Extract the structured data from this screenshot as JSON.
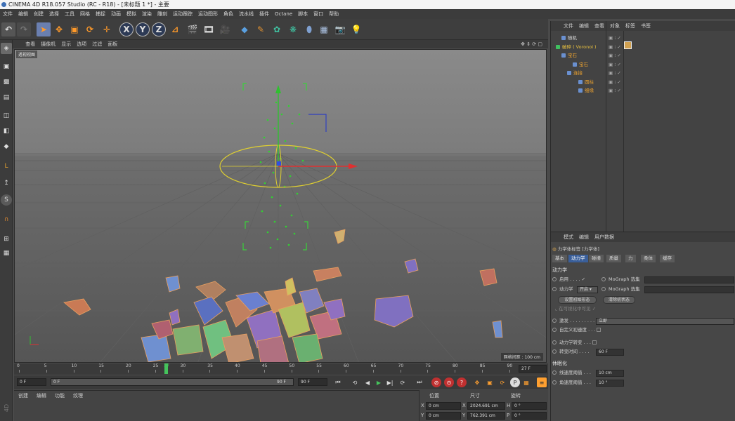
{
  "title": "CINEMA 4D R18.057 Studio (RC - R18) - [未标题 1 *] - 主要",
  "menu": [
    "文件",
    "编辑",
    "创建",
    "选择",
    "工具",
    "网格",
    "捕捉",
    "动画",
    "模拟",
    "渲染",
    "雕刻",
    "运动跟踪",
    "运动图形",
    "角色",
    "流水线",
    "插件",
    "Octane",
    "脚本",
    "窗口",
    "帮助"
  ],
  "toolbar": {
    "undo_icon": "undo-icon",
    "x": "X",
    "y": "Y",
    "z": "Z"
  },
  "viewport_menu": [
    "查看",
    "摄像机",
    "显示",
    "选项",
    "过滤",
    "面板"
  ],
  "viewport": {
    "label": "透视视图",
    "grid_spacing": "网格间距 : 100 cm"
  },
  "timeline": {
    "ticks": [
      "0",
      "5",
      "10",
      "15",
      "20",
      "25",
      "27",
      "30",
      "35",
      "40",
      "45",
      "50",
      "55",
      "60",
      "65",
      "70",
      "75",
      "80",
      "85",
      "90"
    ],
    "current": "27 F"
  },
  "transport": {
    "start": "0 F",
    "range_start": "0 F",
    "range_end": "90 F",
    "end": "90 F"
  },
  "bottom_tabs": [
    "创建",
    "编辑",
    "功能",
    "纹理"
  ],
  "coords": {
    "headers": [
      "位置",
      "尺寸",
      "旋转"
    ],
    "rows": [
      {
        "a": "X",
        "pos": "0 cm",
        "b": "X",
        "size": "2024.691 cm",
        "c": "H",
        "rot": "0 °"
      },
      {
        "a": "Y",
        "pos": "0 cm",
        "b": "Y",
        "size": "762.391 cm",
        "c": "P",
        "rot": "0 °"
      }
    ]
  },
  "object_manager": {
    "menu": [
      "文件",
      "编辑",
      "查看",
      "对象",
      "标签",
      "书签"
    ],
    "items": [
      {
        "label": "随机",
        "color": "#d8d8d8",
        "indent": 10
      },
      {
        "label": "破碎 ( Voronoi )",
        "color": "#e8c040",
        "indent": 2
      },
      {
        "label": "宝石",
        "color": "#e8a030",
        "indent": 10
      },
      {
        "label": "宝石",
        "color": "#e8a030",
        "indent": 26
      },
      {
        "label": "连接",
        "color": "#e8a030",
        "indent": 18
      },
      {
        "label": "圆柱",
        "color": "#e8a030",
        "indent": 34
      },
      {
        "label": "细缘",
        "color": "#e8a030",
        "indent": 34
      }
    ]
  },
  "attributes": {
    "menu": [
      "模式",
      "编辑",
      "用户数据"
    ],
    "header": "力学体标签 [力学体]",
    "tabs": [
      "基本",
      "动力学",
      "碰撞",
      "质量",
      "力",
      "柔体",
      "缓存"
    ],
    "active_tab": "动力学",
    "section_dynamics": "动力学",
    "enable_label": "启用",
    "enable_check": "✓",
    "mograph_sel_1": "MoGraph 选集",
    "dynamics_label": "动力学",
    "dynamics_value": "开启",
    "mograph_sel_2": "MoGraph 选集",
    "btn_set_initial": "设置初始形态",
    "btn_clear_initial": "清除初状态",
    "visible_label": "在可视化中可见",
    "visible_check": "✓",
    "trigger_label": "激发",
    "trigger_value": "立即",
    "custom_init_label": "自定义初速度",
    "dyn_transition_label": "动力学转变",
    "transition_time_label": "转变时间",
    "transition_time_value": "60 F",
    "section_sleep": "休眠化",
    "linear_thresh_label": "线速度阈值",
    "linear_thresh_value": "10 cm",
    "angular_thresh_label": "角速度阈值",
    "angular_thresh_value": "10 °"
  },
  "brand_vertical": "4D"
}
